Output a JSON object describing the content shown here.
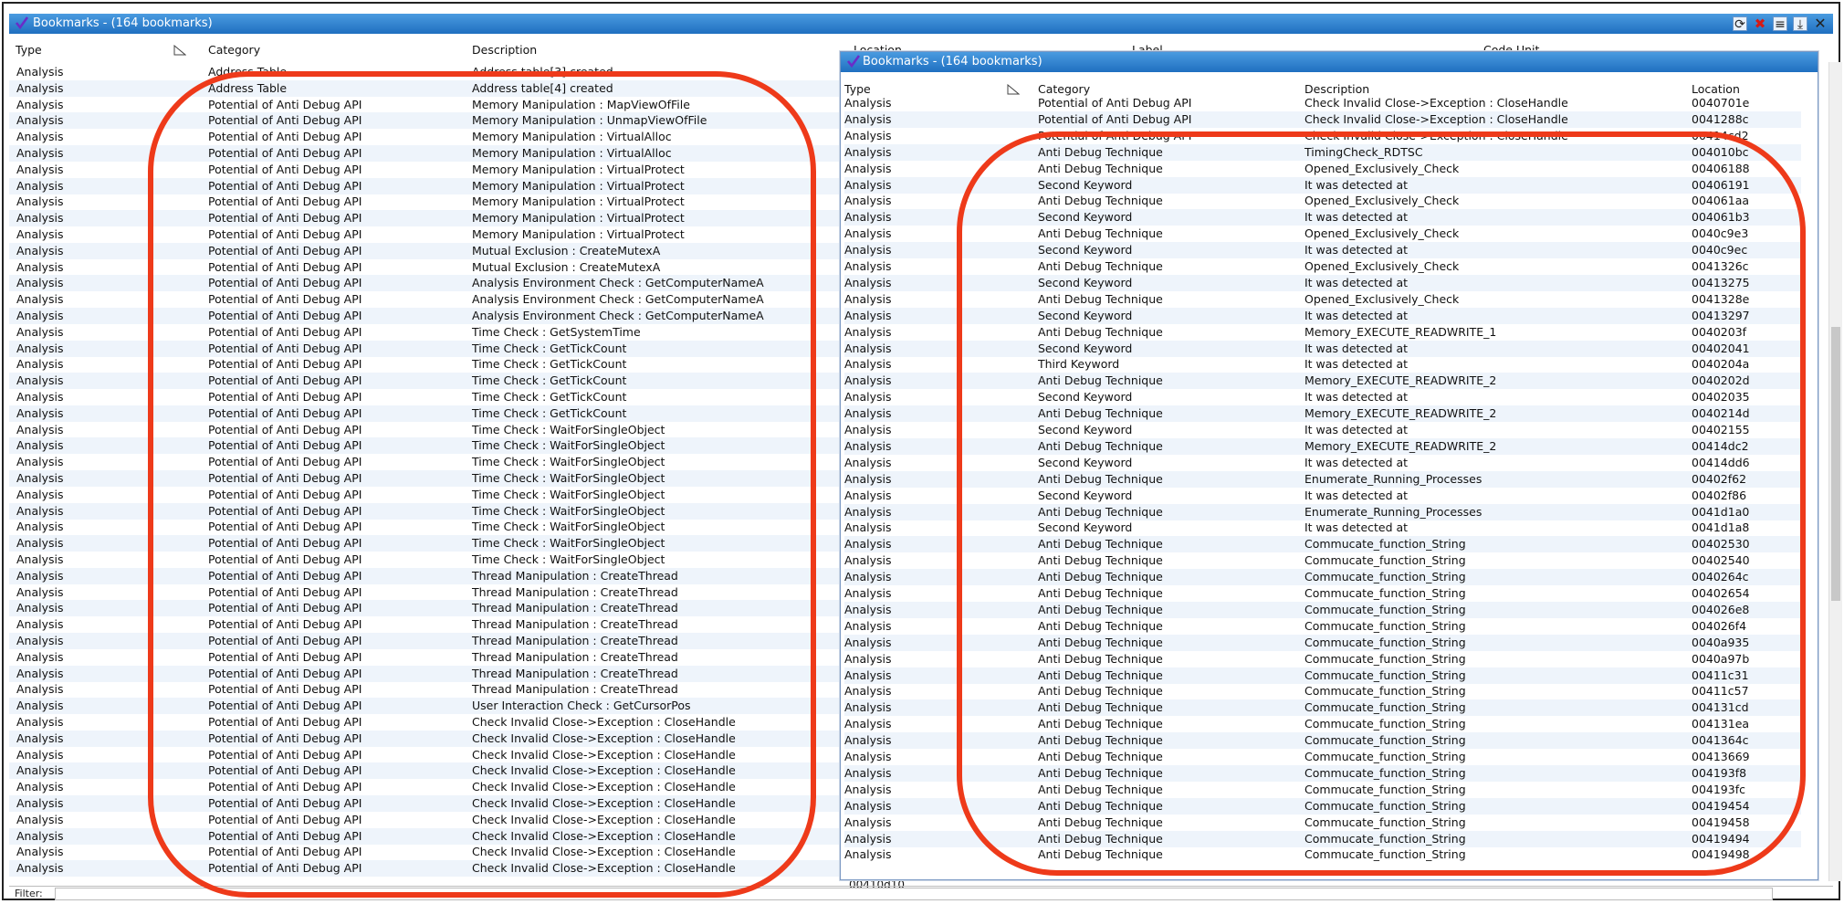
{
  "window": {
    "title": "Bookmarks - (164 bookmarks)",
    "toolbar_icons": [
      "refresh-icon",
      "delete-icon",
      "menu-icon",
      "export-icon",
      "close-icon"
    ],
    "close_label": "✕"
  },
  "columns": {
    "type": "Type",
    "category": "Category",
    "description": "Description",
    "location": "Location",
    "label": "Label",
    "code_unit": "Code Unit"
  },
  "rows": [
    {
      "type": "Analysis",
      "category": "Address Table",
      "description": "Address table[3] created"
    },
    {
      "type": "Analysis",
      "category": "Address Table",
      "description": "Address table[4] created"
    },
    {
      "type": "Analysis",
      "category": "Potential of Anti Debug API",
      "description": "Memory Manipulation : MapViewOfFile"
    },
    {
      "type": "Analysis",
      "category": "Potential of Anti Debug API",
      "description": "Memory Manipulation : UnmapViewOfFile"
    },
    {
      "type": "Analysis",
      "category": "Potential of Anti Debug API",
      "description": "Memory Manipulation : VirtualAlloc"
    },
    {
      "type": "Analysis",
      "category": "Potential of Anti Debug API",
      "description": "Memory Manipulation : VirtualAlloc"
    },
    {
      "type": "Analysis",
      "category": "Potential of Anti Debug API",
      "description": "Memory Manipulation : VirtualProtect"
    },
    {
      "type": "Analysis",
      "category": "Potential of Anti Debug API",
      "description": "Memory Manipulation : VirtualProtect"
    },
    {
      "type": "Analysis",
      "category": "Potential of Anti Debug API",
      "description": "Memory Manipulation : VirtualProtect"
    },
    {
      "type": "Analysis",
      "category": "Potential of Anti Debug API",
      "description": "Memory Manipulation : VirtualProtect"
    },
    {
      "type": "Analysis",
      "category": "Potential of Anti Debug API",
      "description": "Memory Manipulation : VirtualProtect"
    },
    {
      "type": "Analysis",
      "category": "Potential of Anti Debug API",
      "description": "Mutual Exclusion : CreateMutexA"
    },
    {
      "type": "Analysis",
      "category": "Potential of Anti Debug API",
      "description": "Mutual Exclusion : CreateMutexA"
    },
    {
      "type": "Analysis",
      "category": "Potential of Anti Debug API",
      "description": "Analysis Environment Check : GetComputerNameA"
    },
    {
      "type": "Analysis",
      "category": "Potential of Anti Debug API",
      "description": "Analysis Environment Check : GetComputerNameA"
    },
    {
      "type": "Analysis",
      "category": "Potential of Anti Debug API",
      "description": "Analysis Environment Check : GetComputerNameA"
    },
    {
      "type": "Analysis",
      "category": "Potential of Anti Debug API",
      "description": "Time Check : GetSystemTime"
    },
    {
      "type": "Analysis",
      "category": "Potential of Anti Debug API",
      "description": "Time Check : GetTickCount"
    },
    {
      "type": "Analysis",
      "category": "Potential of Anti Debug API",
      "description": "Time Check : GetTickCount"
    },
    {
      "type": "Analysis",
      "category": "Potential of Anti Debug API",
      "description": "Time Check : GetTickCount"
    },
    {
      "type": "Analysis",
      "category": "Potential of Anti Debug API",
      "description": "Time Check : GetTickCount"
    },
    {
      "type": "Analysis",
      "category": "Potential of Anti Debug API",
      "description": "Time Check : GetTickCount"
    },
    {
      "type": "Analysis",
      "category": "Potential of Anti Debug API",
      "description": "Time Check : WaitForSingleObject"
    },
    {
      "type": "Analysis",
      "category": "Potential of Anti Debug API",
      "description": "Time Check : WaitForSingleObject"
    },
    {
      "type": "Analysis",
      "category": "Potential of Anti Debug API",
      "description": "Time Check : WaitForSingleObject"
    },
    {
      "type": "Analysis",
      "category": "Potential of Anti Debug API",
      "description": "Time Check : WaitForSingleObject"
    },
    {
      "type": "Analysis",
      "category": "Potential of Anti Debug API",
      "description": "Time Check : WaitForSingleObject"
    },
    {
      "type": "Analysis",
      "category": "Potential of Anti Debug API",
      "description": "Time Check : WaitForSingleObject"
    },
    {
      "type": "Analysis",
      "category": "Potential of Anti Debug API",
      "description": "Time Check : WaitForSingleObject"
    },
    {
      "type": "Analysis",
      "category": "Potential of Anti Debug API",
      "description": "Time Check : WaitForSingleObject"
    },
    {
      "type": "Analysis",
      "category": "Potential of Anti Debug API",
      "description": "Time Check : WaitForSingleObject"
    },
    {
      "type": "Analysis",
      "category": "Potential of Anti Debug API",
      "description": "Thread Manipulation : CreateThread"
    },
    {
      "type": "Analysis",
      "category": "Potential of Anti Debug API",
      "description": "Thread Manipulation : CreateThread"
    },
    {
      "type": "Analysis",
      "category": "Potential of Anti Debug API",
      "description": "Thread Manipulation : CreateThread"
    },
    {
      "type": "Analysis",
      "category": "Potential of Anti Debug API",
      "description": "Thread Manipulation : CreateThread"
    },
    {
      "type": "Analysis",
      "category": "Potential of Anti Debug API",
      "description": "Thread Manipulation : CreateThread"
    },
    {
      "type": "Analysis",
      "category": "Potential of Anti Debug API",
      "description": "Thread Manipulation : CreateThread"
    },
    {
      "type": "Analysis",
      "category": "Potential of Anti Debug API",
      "description": "Thread Manipulation : CreateThread"
    },
    {
      "type": "Analysis",
      "category": "Potential of Anti Debug API",
      "description": "Thread Manipulation : CreateThread"
    },
    {
      "type": "Analysis",
      "category": "Potential of Anti Debug API",
      "description": "User Interaction Check : GetCursorPos"
    },
    {
      "type": "Analysis",
      "category": "Potential of Anti Debug API",
      "description": "Check Invalid Close->Exception : CloseHandle"
    },
    {
      "type": "Analysis",
      "category": "Potential of Anti Debug API",
      "description": "Check Invalid Close->Exception : CloseHandle"
    },
    {
      "type": "Analysis",
      "category": "Potential of Anti Debug API",
      "description": "Check Invalid Close->Exception : CloseHandle"
    },
    {
      "type": "Analysis",
      "category": "Potential of Anti Debug API",
      "description": "Check Invalid Close->Exception : CloseHandle"
    },
    {
      "type": "Analysis",
      "category": "Potential of Anti Debug API",
      "description": "Check Invalid Close->Exception : CloseHandle"
    },
    {
      "type": "Analysis",
      "category": "Potential of Anti Debug API",
      "description": "Check Invalid Close->Exception : CloseHandle"
    },
    {
      "type": "Analysis",
      "category": "Potential of Anti Debug API",
      "description": "Check Invalid Close->Exception : CloseHandle"
    },
    {
      "type": "Analysis",
      "category": "Potential of Anti Debug API",
      "description": "Check Invalid Close->Exception : CloseHandle"
    },
    {
      "type": "Analysis",
      "category": "Potential of Anti Debug API",
      "description": "Check Invalid Close->Exception : CloseHandle"
    },
    {
      "type": "Analysis",
      "category": "Potential of Anti Debug API",
      "description": "Check Invalid Close->Exception : CloseHandle"
    }
  ],
  "filter": {
    "label": "Filter:"
  },
  "bottom_partial": "00410d10",
  "overlay": {
    "title": "Bookmarks - (164 bookmarks)",
    "rows": [
      {
        "type": "Analysis",
        "category": "Potential of Anti Debug API",
        "description": "Check Invalid Close->Exception : CloseHandle",
        "location": "0040701e"
      },
      {
        "type": "Analysis",
        "category": "Potential of Anti Debug API",
        "description": "Check Invalid Close->Exception : CloseHandle",
        "location": "0041288c"
      },
      {
        "type": "Analysis",
        "category": "Potential of Anti Debug API",
        "description": "Check Invalid Close->Exception : CloseHandle",
        "location": "00414cd2"
      },
      {
        "type": "Analysis",
        "category": "Anti Debug Technique",
        "description": "TimingCheck_RDTSC",
        "location": "004010bc"
      },
      {
        "type": "Analysis",
        "category": "Anti Debug Technique",
        "description": "Opened_Exclusively_Check",
        "location": "00406188"
      },
      {
        "type": "Analysis",
        "category": "Second Keyword",
        "description": "It was detected at",
        "location": "00406191"
      },
      {
        "type": "Analysis",
        "category": "Anti Debug Technique",
        "description": "Opened_Exclusively_Check",
        "location": "004061aa"
      },
      {
        "type": "Analysis",
        "category": "Second Keyword",
        "description": "It was detected at",
        "location": "004061b3"
      },
      {
        "type": "Analysis",
        "category": "Anti Debug Technique",
        "description": "Opened_Exclusively_Check",
        "location": "0040c9e3"
      },
      {
        "type": "Analysis",
        "category": "Second Keyword",
        "description": "It was detected at",
        "location": "0040c9ec"
      },
      {
        "type": "Analysis",
        "category": "Anti Debug Technique",
        "description": "Opened_Exclusively_Check",
        "location": "0041326c"
      },
      {
        "type": "Analysis",
        "category": "Second Keyword",
        "description": "It was detected at",
        "location": "00413275"
      },
      {
        "type": "Analysis",
        "category": "Anti Debug Technique",
        "description": "Opened_Exclusively_Check",
        "location": "0041328e"
      },
      {
        "type": "Analysis",
        "category": "Second Keyword",
        "description": "It was detected at",
        "location": "00413297"
      },
      {
        "type": "Analysis",
        "category": "Anti Debug Technique",
        "description": "Memory_EXECUTE_READWRITE_1",
        "location": "0040203f"
      },
      {
        "type": "Analysis",
        "category": "Second Keyword",
        "description": "It was detected at",
        "location": "00402041"
      },
      {
        "type": "Analysis",
        "category": "Third Keyword",
        "description": "It was detected at",
        "location": "0040204a"
      },
      {
        "type": "Analysis",
        "category": "Anti Debug Technique",
        "description": "Memory_EXECUTE_READWRITE_2",
        "location": "0040202d"
      },
      {
        "type": "Analysis",
        "category": "Second Keyword",
        "description": "It was detected at",
        "location": "00402035"
      },
      {
        "type": "Analysis",
        "category": "Anti Debug Technique",
        "description": "Memory_EXECUTE_READWRITE_2",
        "location": "0040214d"
      },
      {
        "type": "Analysis",
        "category": "Second Keyword",
        "description": "It was detected at",
        "location": "00402155"
      },
      {
        "type": "Analysis",
        "category": "Anti Debug Technique",
        "description": "Memory_EXECUTE_READWRITE_2",
        "location": "00414dc2"
      },
      {
        "type": "Analysis",
        "category": "Second Keyword",
        "description": "It was detected at",
        "location": "00414dd6"
      },
      {
        "type": "Analysis",
        "category": "Anti Debug Technique",
        "description": "Enumerate_Running_Processes",
        "location": "00402f62"
      },
      {
        "type": "Analysis",
        "category": "Second Keyword",
        "description": "It was detected at",
        "location": "00402f86"
      },
      {
        "type": "Analysis",
        "category": "Anti Debug Technique",
        "description": "Enumerate_Running_Processes",
        "location": "0041d1a0"
      },
      {
        "type": "Analysis",
        "category": "Second Keyword",
        "description": "It was detected at",
        "location": "0041d1a8"
      },
      {
        "type": "Analysis",
        "category": "Anti Debug Technique",
        "description": "Commucate_function_String",
        "location": "00402530"
      },
      {
        "type": "Analysis",
        "category": "Anti Debug Technique",
        "description": "Commucate_function_String",
        "location": "00402540"
      },
      {
        "type": "Analysis",
        "category": "Anti Debug Technique",
        "description": "Commucate_function_String",
        "location": "0040264c"
      },
      {
        "type": "Analysis",
        "category": "Anti Debug Technique",
        "description": "Commucate_function_String",
        "location": "00402654"
      },
      {
        "type": "Analysis",
        "category": "Anti Debug Technique",
        "description": "Commucate_function_String",
        "location": "004026e8"
      },
      {
        "type": "Analysis",
        "category": "Anti Debug Technique",
        "description": "Commucate_function_String",
        "location": "004026f4"
      },
      {
        "type": "Analysis",
        "category": "Anti Debug Technique",
        "description": "Commucate_function_String",
        "location": "0040a935"
      },
      {
        "type": "Analysis",
        "category": "Anti Debug Technique",
        "description": "Commucate_function_String",
        "location": "0040a97b"
      },
      {
        "type": "Analysis",
        "category": "Anti Debug Technique",
        "description": "Commucate_function_String",
        "location": "00411c31"
      },
      {
        "type": "Analysis",
        "category": "Anti Debug Technique",
        "description": "Commucate_function_String",
        "location": "00411c57"
      },
      {
        "type": "Analysis",
        "category": "Anti Debug Technique",
        "description": "Commucate_function_String",
        "location": "004131cd"
      },
      {
        "type": "Analysis",
        "category": "Anti Debug Technique",
        "description": "Commucate_function_String",
        "location": "004131ea"
      },
      {
        "type": "Analysis",
        "category": "Anti Debug Technique",
        "description": "Commucate_function_String",
        "location": "0041364c"
      },
      {
        "type": "Analysis",
        "category": "Anti Debug Technique",
        "description": "Commucate_function_String",
        "location": "00413669"
      },
      {
        "type": "Analysis",
        "category": "Anti Debug Technique",
        "description": "Commucate_function_String",
        "location": "004193f8"
      },
      {
        "type": "Analysis",
        "category": "Anti Debug Technique",
        "description": "Commucate_function_String",
        "location": "004193fc"
      },
      {
        "type": "Analysis",
        "category": "Anti Debug Technique",
        "description": "Commucate_function_String",
        "location": "00419454"
      },
      {
        "type": "Analysis",
        "category": "Anti Debug Technique",
        "description": "Commucate_function_String",
        "location": "00419458"
      },
      {
        "type": "Analysis",
        "category": "Anti Debug Technique",
        "description": "Commucate_function_String",
        "location": "00419494"
      },
      {
        "type": "Analysis",
        "category": "Anti Debug Technique",
        "description": "Commucate_function_String",
        "location": "00419498"
      }
    ]
  },
  "colors": {
    "title_bar": "#1f6fc0",
    "highlight_ellipse": "#ee3a1a",
    "row_alt": "#eef4fb"
  }
}
